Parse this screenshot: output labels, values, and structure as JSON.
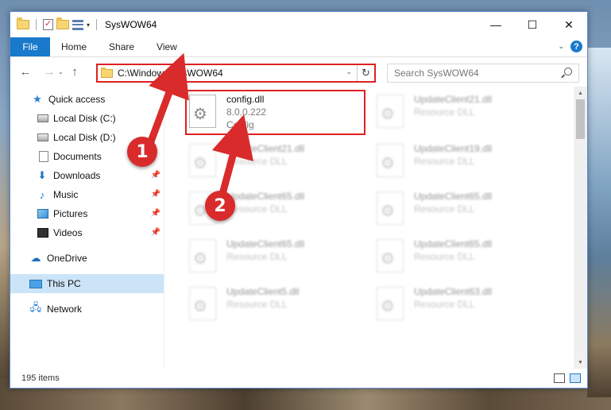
{
  "window": {
    "title": "SysWOW64",
    "controls": {
      "minimize": "—",
      "maximize": "☐",
      "close": "✕"
    }
  },
  "ribbon": {
    "tabs": [
      "File",
      "Home",
      "Share",
      "View"
    ],
    "help": "?"
  },
  "navigation": {
    "address": "C:\\Windows\\SysWOW64",
    "search_placeholder": "Search SysWOW64"
  },
  "sidebar": {
    "items": [
      {
        "label": "Quick access",
        "icon": "star-icon"
      },
      {
        "label": "Local Disk (C:)",
        "icon": "disk-icon",
        "pinned": false
      },
      {
        "label": "Local Disk (D:)",
        "icon": "disk-icon",
        "pinned": false
      },
      {
        "label": "Documents",
        "icon": "document-icon",
        "pinned": false
      },
      {
        "label": "Downloads",
        "icon": "download-icon",
        "pinned": true
      },
      {
        "label": "Music",
        "icon": "music-icon",
        "pinned": true
      },
      {
        "label": "Pictures",
        "icon": "pictures-icon",
        "pinned": true
      },
      {
        "label": "Videos",
        "icon": "videos-icon",
        "pinned": true
      },
      {
        "label": "OneDrive",
        "icon": "cloud-icon"
      },
      {
        "label": "This PC",
        "icon": "computer-icon",
        "selected": true
      },
      {
        "label": "Network",
        "icon": "network-icon"
      }
    ]
  },
  "files": [
    {
      "name": "config.dll",
      "version": "8.0.0.222",
      "desc": "Config",
      "highlighted": true
    },
    {
      "name": "UpdateClient21.dll",
      "desc": "Resource DLL"
    },
    {
      "name": "UpdateClient21.dll",
      "desc": "Resource DLL"
    },
    {
      "name": "UpdateClient19.dll",
      "desc": "Resource DLL"
    },
    {
      "name": "UpdateClient65.dll",
      "desc": "Resource DLL"
    },
    {
      "name": "UpdateClient65.dll",
      "desc": "Resource DLL"
    },
    {
      "name": "UpdateClient65.dll",
      "desc": "Resource DLL"
    },
    {
      "name": "UpdateClient65.dll",
      "desc": "Resource DLL"
    },
    {
      "name": "UpdateClient5.dll",
      "desc": "Resource DLL"
    },
    {
      "name": "UpdateClient63.dll",
      "desc": "Resource DLL"
    }
  ],
  "status": {
    "item_count": "195 items"
  },
  "annotations": {
    "step1": "1",
    "step2": "2",
    "color": "#d92b2b"
  }
}
